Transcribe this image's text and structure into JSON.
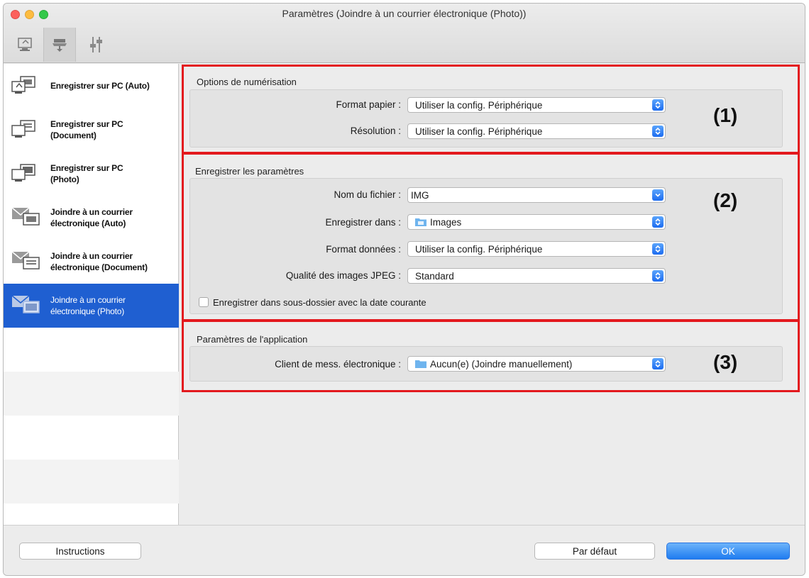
{
  "window": {
    "title": "Paramètres (Joindre à un courrier électronique (Photo))",
    "toolbar_tabs": [
      {
        "icon": "computer-scan-icon"
      },
      {
        "icon": "scanner-device-icon",
        "active": true
      },
      {
        "icon": "general-settings-icon"
      }
    ]
  },
  "sidebar": {
    "items": [
      {
        "label": "Enregistrer sur PC (Auto)",
        "icon": "save-to-pc-icon"
      },
      {
        "label": "Enregistrer sur PC\n(Document)",
        "icon": "save-to-pc-icon"
      },
      {
        "label": "Enregistrer sur PC\n(Photo)",
        "icon": "save-to-pc-icon"
      },
      {
        "label": "Joindre à un courrier\nélectronique (Auto)",
        "icon": "mail-attach-icon"
      },
      {
        "label": "Joindre à un courrier\nélectronique (Document)",
        "icon": "mail-attach-icon"
      },
      {
        "label": "Joindre à un courrier\nélectronique (Photo)",
        "icon": "mail-attach-icon",
        "selected": true
      }
    ]
  },
  "scan_options": {
    "title": "Options de numérisation",
    "paper_size_label": "Format papier :",
    "paper_size_value": "Utiliser la config. Périphérique",
    "resolution_label": "Résolution :",
    "resolution_value": "Utiliser la config. Périphérique",
    "marker": "(1)"
  },
  "save_settings": {
    "title": "Enregistrer les paramètres",
    "filename_label": "Nom du fichier :",
    "filename_value": "IMG",
    "save_in_label": "Enregistrer dans :",
    "save_in_value": "Images",
    "data_format_label": "Format données :",
    "data_format_value": "Utiliser la config. Périphérique",
    "jpeg_quality_label": "Qualité des images JPEG :",
    "jpeg_quality_value": "Standard",
    "subfolder_checkbox_label": "Enregistrer dans sous-dossier avec la date courante",
    "subfolder_checked": false,
    "marker": "(2)"
  },
  "app_settings": {
    "title": "Paramètres de l'application",
    "mail_client_label": "Client de mess. électronique :",
    "mail_client_value": "Aucun(e) (Joindre manuellement)",
    "marker": "(3)"
  },
  "footer": {
    "instructions_label": "Instructions",
    "default_label": "Par défaut",
    "ok_label": "OK"
  },
  "colors": {
    "highlight": "#e3191e",
    "selection": "#1f5fd1",
    "accent_blue": "#1d6cf0"
  }
}
